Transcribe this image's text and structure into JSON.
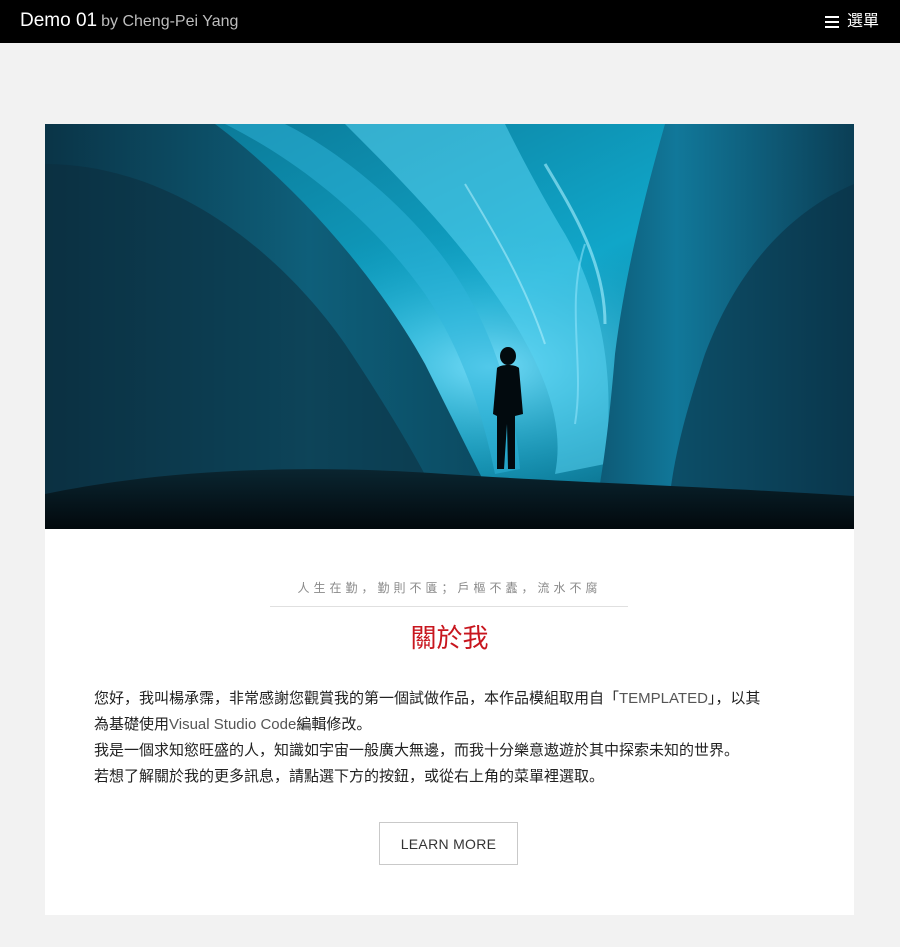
{
  "header": {
    "title": "Demo 01",
    "byline": "by Cheng-Pei Yang",
    "menu_label": "選單",
    "menu_icon": "hamburger-menu-icon"
  },
  "hero": {
    "scene": "ice-cave-silhouette"
  },
  "about": {
    "tagline": "人生在勤，勤則不匱；戶樞不蠹，流水不腐",
    "heading": "關於我",
    "line1_a": "您好，我叫楊承霈，非常感謝您觀賞我的第一個試做作品，本作品模組取用自「",
    "line1_b": "TEMPLATED",
    "line1_c": "」，以其",
    "line2_a": "為基礎使用",
    "line2_b": "Visual Studio Code",
    "line2_c": "編輯修改。",
    "line3": "我是一個求知慾旺盛的人，知識如宇宙一般廣大無邊，而我十分樂意遨遊於其中探索未知的世界。",
    "line4": "若想了解關於我的更多訊息，請點選下方的按鈕，或從右上角的菜單裡選取。",
    "button_label": "LEARN MORE"
  },
  "colors": {
    "topbar": "#000000",
    "heading": "#c8161e",
    "page_bg": "#f2f2f2"
  }
}
